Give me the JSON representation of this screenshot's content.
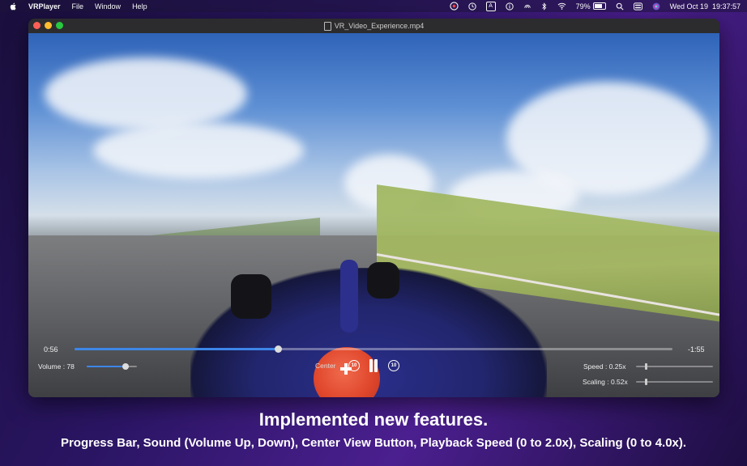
{
  "menubar": {
    "app_name": "VRPlayer",
    "items": [
      "File",
      "Window",
      "Help"
    ],
    "battery": "79%",
    "datetime": "Wed Oct 19  19:37:57",
    "input_source": "A"
  },
  "window": {
    "title": "VR_Video_Experience.mp4"
  },
  "player": {
    "elapsed": "0:56",
    "remaining": "-1:55",
    "progress_fraction": 0.34,
    "volume_label": "Volume : 78",
    "volume_level": 78,
    "center_label": "Center",
    "skip_back": "10",
    "skip_forward": "10",
    "speed_label": "Speed : 0.25x",
    "speed_fraction": 0.125,
    "scaling_label": "Scaling : 0.52x",
    "scaling_fraction": 0.13,
    "accent_color": "#3d86e8"
  },
  "captions": {
    "title": "Implemented new features.",
    "subtitle": "Progress Bar, Sound (Volume Up, Down), Center View Button, Playback Speed (0 to 2.0x), Scaling (0 to 4.0x)."
  }
}
